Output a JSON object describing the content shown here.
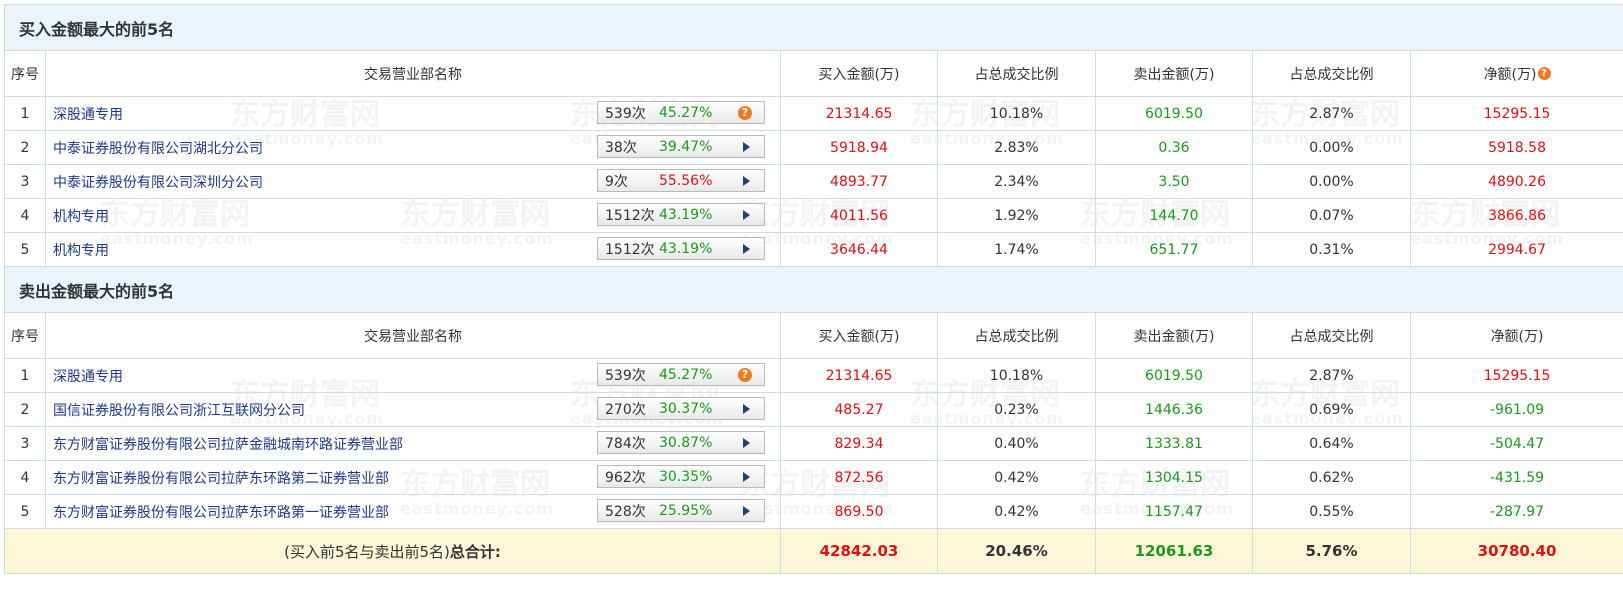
{
  "buy_section": {
    "title": "买入金额最大的前5名",
    "headers": {
      "seq": "序号",
      "name": "交易营业部名称",
      "buy": "买入金额(万)",
      "buy_ratio": "占总成交比例",
      "sell": "卖出金额(万)",
      "sell_ratio": "占总成交比例",
      "net": "净额(万)"
    },
    "rows": [
      {
        "seq": "1",
        "name": "深股通专用",
        "count": "539次",
        "rate": "45.27%",
        "buy": "21314.65",
        "buy_ratio": "10.18%",
        "sell": "6019.50",
        "sell_ratio": "2.87%",
        "net": "15295.15"
      },
      {
        "seq": "2",
        "name": "中泰证券股份有限公司湖北分公司",
        "count": "38次",
        "rate": "39.47%",
        "buy": "5918.94",
        "buy_ratio": "2.83%",
        "sell": "0.36",
        "sell_ratio": "0.00%",
        "net": "5918.58"
      },
      {
        "seq": "3",
        "name": "中泰证券股份有限公司深圳分公司",
        "count": "9次",
        "rate": "55.56%",
        "buy": "4893.77",
        "buy_ratio": "2.34%",
        "sell": "3.50",
        "sell_ratio": "0.00%",
        "net": "4890.26"
      },
      {
        "seq": "4",
        "name": "机构专用",
        "count": "1512次",
        "rate": "43.19%",
        "buy": "4011.56",
        "buy_ratio": "1.92%",
        "sell": "144.70",
        "sell_ratio": "0.07%",
        "net": "3866.86"
      },
      {
        "seq": "5",
        "name": "机构专用",
        "count": "1512次",
        "rate": "43.19%",
        "buy": "3646.44",
        "buy_ratio": "1.74%",
        "sell": "651.77",
        "sell_ratio": "0.31%",
        "net": "2994.67"
      }
    ]
  },
  "sell_section": {
    "title": "卖出金额最大的前5名",
    "headers": {
      "seq": "序号",
      "name": "交易营业部名称",
      "buy": "买入金额(万)",
      "buy_ratio": "占总成交比例",
      "sell": "卖出金额(万)",
      "sell_ratio": "占总成交比例",
      "net": "净额(万)"
    },
    "rows": [
      {
        "seq": "1",
        "name": "深股通专用",
        "count": "539次",
        "rate": "45.27%",
        "buy": "21314.65",
        "buy_ratio": "10.18%",
        "sell": "6019.50",
        "sell_ratio": "2.87%",
        "net": "15295.15"
      },
      {
        "seq": "2",
        "name": "国信证券股份有限公司浙江互联网分公司",
        "count": "270次",
        "rate": "30.37%",
        "buy": "485.27",
        "buy_ratio": "0.23%",
        "sell": "1446.36",
        "sell_ratio": "0.69%",
        "net": "-961.09"
      },
      {
        "seq": "3",
        "name": "东方财富证券股份有限公司拉萨金融城南环路证券营业部",
        "count": "784次",
        "rate": "30.87%",
        "buy": "829.34",
        "buy_ratio": "0.40%",
        "sell": "1333.81",
        "sell_ratio": "0.64%",
        "net": "-504.47"
      },
      {
        "seq": "4",
        "name": "东方财富证券股份有限公司拉萨东环路第二证券营业部",
        "count": "962次",
        "rate": "30.35%",
        "buy": "872.56",
        "buy_ratio": "0.42%",
        "sell": "1304.15",
        "sell_ratio": "0.62%",
        "net": "-431.59"
      },
      {
        "seq": "5",
        "name": "东方财富证券股份有限公司拉萨东环路第一证券营业部",
        "count": "528次",
        "rate": "25.95%",
        "buy": "869.50",
        "buy_ratio": "0.42%",
        "sell": "1157.47",
        "sell_ratio": "0.55%",
        "net": "-287.97"
      }
    ]
  },
  "total": {
    "label_prefix": "(买入前5名与卖出前5名)",
    "label_suffix": "总合计:",
    "buy": "42842.03",
    "buy_ratio": "20.46%",
    "sell": "12061.63",
    "sell_ratio": "5.76%",
    "net": "30780.40"
  },
  "watermark": {
    "cn": "东方财富网",
    "en": "eastmoney.com"
  },
  "icons": {
    "help": "help-icon",
    "expand": "play-triangle-icon"
  },
  "colors": {
    "buy": "#e01010",
    "sell": "#1a9a1a",
    "header_bg": "#ebf3fb",
    "total_bg": "#fdf7d8",
    "border": "#cfdde9"
  }
}
